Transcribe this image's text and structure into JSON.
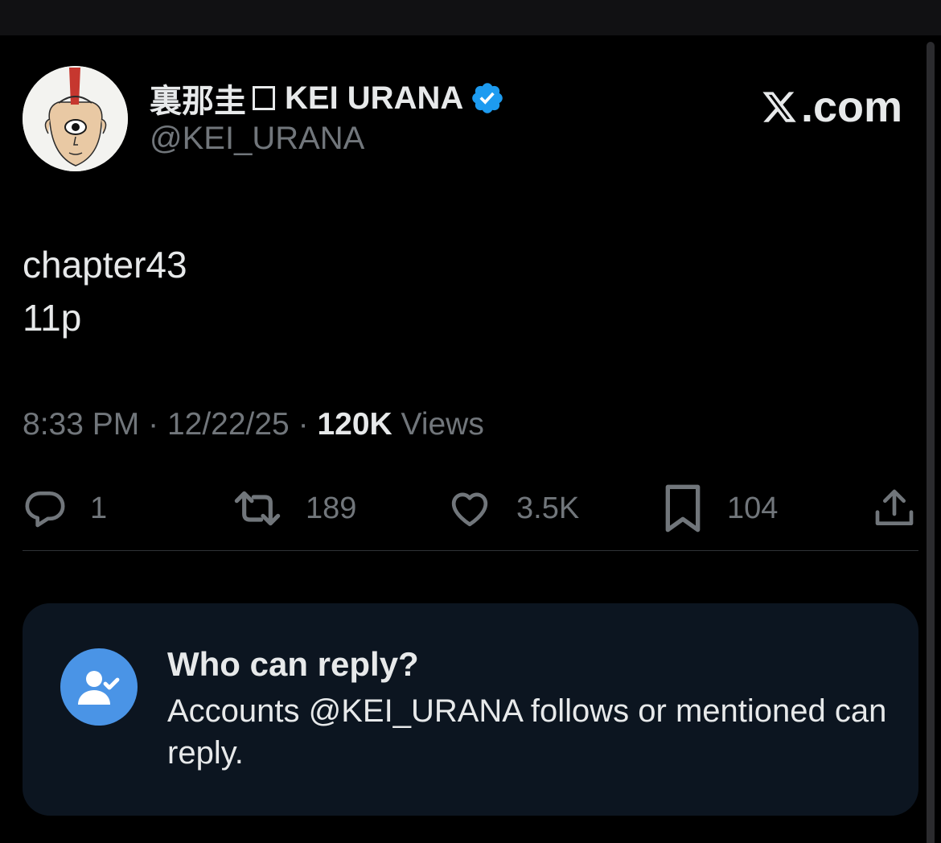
{
  "author": {
    "display_name_jp": "裏那圭",
    "display_name_en": "KEI URANA",
    "handle": "@KEI_URANA",
    "verified": true,
    "verified_color": "#1d9bf0"
  },
  "watermark": {
    "text": ".com",
    "logo": "x-logo-icon"
  },
  "tweet": {
    "lines": [
      "chapter43",
      "11p"
    ]
  },
  "meta": {
    "time": "8:33 PM",
    "date": "12/22/25",
    "views_count": "120K",
    "views_label": "Views",
    "separator": "·"
  },
  "actions": {
    "reply": {
      "icon": "reply-icon",
      "count": "1"
    },
    "repost": {
      "icon": "repost-icon",
      "count": "189"
    },
    "like": {
      "icon": "heart-icon",
      "count": "3.5K"
    },
    "bookmark": {
      "icon": "bookmark-icon",
      "count": "104"
    },
    "share": {
      "icon": "share-icon"
    }
  },
  "reply_settings": {
    "title": "Who can reply?",
    "body": "Accounts @KEI_URANA follows or mentioned can reply.",
    "icon": "user-check-icon",
    "accent": "#4a94e6"
  },
  "colors": {
    "background": "#000000",
    "text": "#e7e9ea",
    "muted": "#71767b",
    "card": "#0c1520"
  }
}
